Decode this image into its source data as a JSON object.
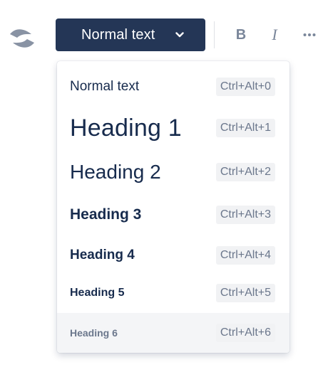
{
  "toolbar": {
    "text_style_select": {
      "selected": "Normal text",
      "icon": "chevron-down-icon"
    },
    "bold_label": "B",
    "italic_label": "I",
    "more_icon": "more-horizontal-icon",
    "logo_icon": "confluence-logo-icon"
  },
  "menu": {
    "items": [
      {
        "label": "Normal text",
        "shortcut": "Ctrl+Alt+0"
      },
      {
        "label": "Heading 1",
        "shortcut": "Ctrl+Alt+1"
      },
      {
        "label": "Heading 2",
        "shortcut": "Ctrl+Alt+2"
      },
      {
        "label": "Heading 3",
        "shortcut": "Ctrl+Alt+3"
      },
      {
        "label": "Heading 4",
        "shortcut": "Ctrl+Alt+4"
      },
      {
        "label": "Heading 5",
        "shortcut": "Ctrl+Alt+5"
      },
      {
        "label": "Heading 6",
        "shortcut": "Ctrl+Alt+6"
      }
    ],
    "hovered_item": "Heading 6"
  },
  "colors": {
    "select_background": "#243656",
    "text_primary": "#172b4d",
    "text_muted": "#6b778c",
    "hover_background": "#f4f5f7"
  }
}
